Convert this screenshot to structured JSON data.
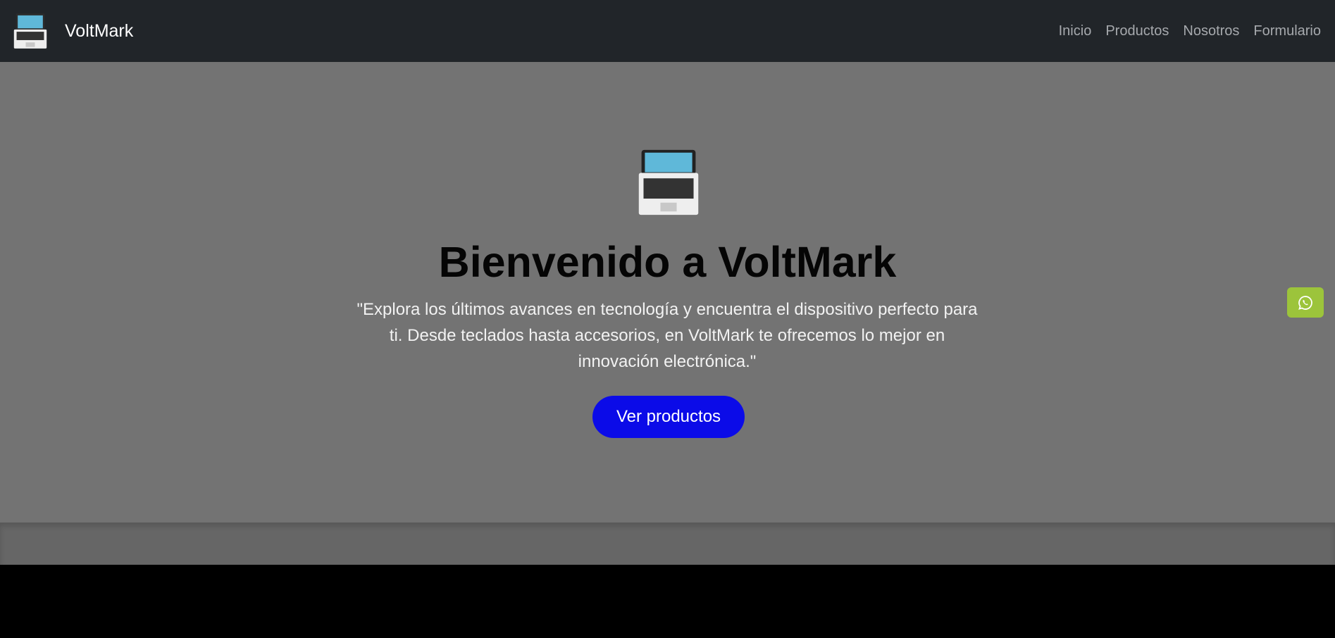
{
  "brand": {
    "name": "VoltMark",
    "logo_icon": "laptop-icon"
  },
  "nav": {
    "links": [
      {
        "label": "Inicio"
      },
      {
        "label": "Productos"
      },
      {
        "label": "Nosotros"
      },
      {
        "label": "Formulario"
      }
    ]
  },
  "hero": {
    "icon": "laptop-icon",
    "title": "Bienvenido a VoltMark",
    "text": "\"Explora los últimos avances en tecnología y encuentra el dispositivo perfecto para ti. Desde teclados hasta accesorios, en VoltMark te ofrecemos lo mejor en innovación electrónica.\"",
    "button_label": "Ver productos"
  },
  "floating": {
    "icon": "whatsapp-icon"
  },
  "colors": {
    "navbar": "#212529",
    "hero_bg": "#737373",
    "button": "#0b0be8",
    "whatsapp": "#9cc43b",
    "band": "#666666"
  }
}
